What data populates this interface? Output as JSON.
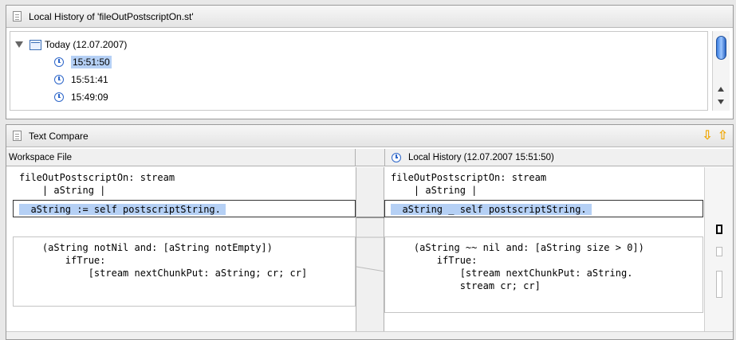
{
  "history": {
    "title": "Local History of 'fileOutPostscriptOn.st'",
    "group_label": "Today (12.07.2007)",
    "entries": [
      "15:51:50",
      "15:51:41",
      "15:49:09"
    ],
    "selected_entry": "15:51:50"
  },
  "compare": {
    "title": "Text Compare",
    "left_header": "Workspace File",
    "right_header": "Local History (12.07.2007 15:51:50)",
    "left_lines": [
      "fileOutPostscriptOn: stream",
      "    | aString |",
      "",
      "  aString := self postscriptString.",
      "",
      "    (aString notNil and: [aString notEmpty])",
      "        ifTrue:",
      "            [stream nextChunkPut: aString; cr; cr]"
    ],
    "right_lines": [
      "fileOutPostscriptOn: stream",
      "    | aString |",
      "",
      "  aString _ self postscriptString.",
      "",
      "    (aString ~~ nil and: [aString size > 0])",
      "        ifTrue:",
      "            [stream nextChunkPut: aString.",
      "            stream cr; cr]"
    ]
  },
  "icons": {
    "document": "document-icon",
    "calendar": "calendar-icon",
    "clock": "clock-icon",
    "next_diff": "down-arrow-icon",
    "prev_diff": "up-arrow-icon"
  },
  "colors": {
    "selection": "#b5d0f5",
    "nav_arrow": "#f0a600",
    "clock": "#2d66c9"
  }
}
